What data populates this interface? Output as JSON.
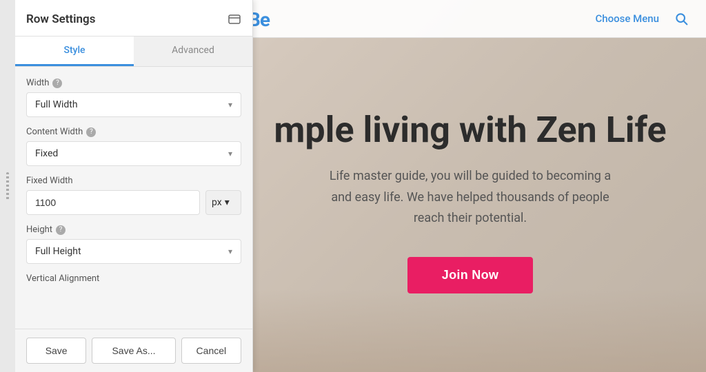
{
  "topbar": {
    "logo_text": "Be",
    "choose_menu_label": "Choose Menu",
    "search_icon": "search-icon"
  },
  "panel": {
    "title": "Row Settings",
    "tabs": [
      {
        "label": "Style",
        "active": true
      },
      {
        "label": "Advanced",
        "active": false
      }
    ],
    "fields": {
      "width_label": "Width",
      "width_value": "Full Width",
      "content_width_label": "Content Width",
      "content_width_value": "Fixed",
      "fixed_width_label": "Fixed Width",
      "fixed_width_value": "1100",
      "fixed_width_unit": "px",
      "height_label": "Height",
      "height_value": "Full Height",
      "vertical_alignment_label": "Vertical Alignment"
    },
    "footer": {
      "save_label": "Save",
      "save_as_label": "Save As...",
      "cancel_label": "Cancel"
    }
  },
  "hero": {
    "title": "mple living with Zen Life",
    "subtitle_line1": "Life master guide, you will be guided to becoming a",
    "subtitle_line2": "and easy life. We have helped thousands of people",
    "subtitle_line3": "reach their potential.",
    "cta_label": "Join Now"
  }
}
